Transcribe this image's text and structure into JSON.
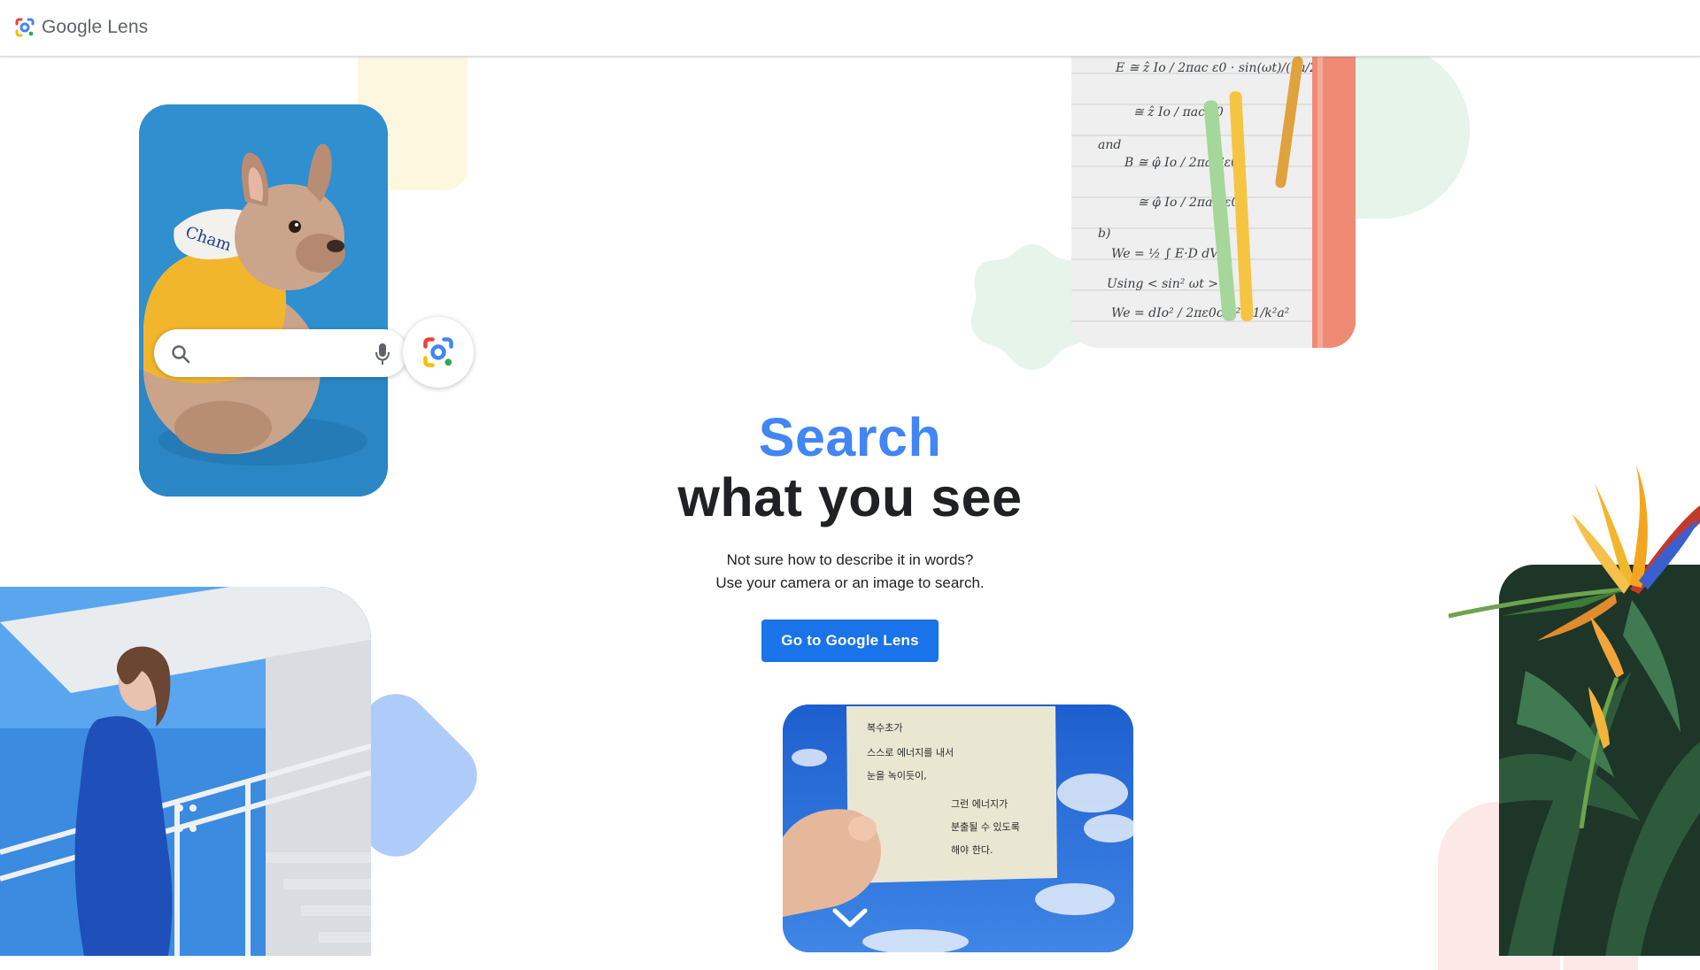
{
  "header": {
    "brand_google": "Google",
    "brand_lens": "Lens",
    "logo_icon": "google-lens-icon"
  },
  "hero": {
    "title_accent": "Search",
    "title_rest": "what you see",
    "subtitle_line1": "Not sure how to describe it in words?",
    "subtitle_line2": "Use your camera or an image to search.",
    "cta_label": "Go to Google Lens"
  },
  "search_mock": {
    "search_icon": "search-icon",
    "mic_icon": "microphone-icon",
    "lens_icon": "google-lens-icon"
  },
  "note_photo": {
    "lines": [
      "복수초가",
      "스스로 에너지를 내서",
      "눈을 녹이듯이,",
      "그런 에너지가",
      "분출될 수 있도록",
      "해야 한다."
    ]
  },
  "math_photo": {
    "lines": [
      "E ≅ ẑ  Io / 2πac ε0 · sin(ωt)/(ka/2)",
      "≅ ẑ  Io / πac ε0",
      "and",
      "B ≅ φ̂  Io / 2πac²ε0",
      "≅ φ̂  Io / 2πac²ε0",
      "b)",
      "We = ½ ∫ E·D dV",
      "Using  < sin² ωt >",
      "We = dIo² / 2πε0c²a² · 1/k²a²"
    ]
  },
  "scroll_icon": "chevron-down-icon",
  "colors": {
    "accent_blue": "#4285f4",
    "button_blue": "#1a73e8",
    "mint": "#e6f4ea",
    "yellow": "#fef7e0",
    "pink": "#fce8e6",
    "periwinkle": "#aecbfa"
  }
}
